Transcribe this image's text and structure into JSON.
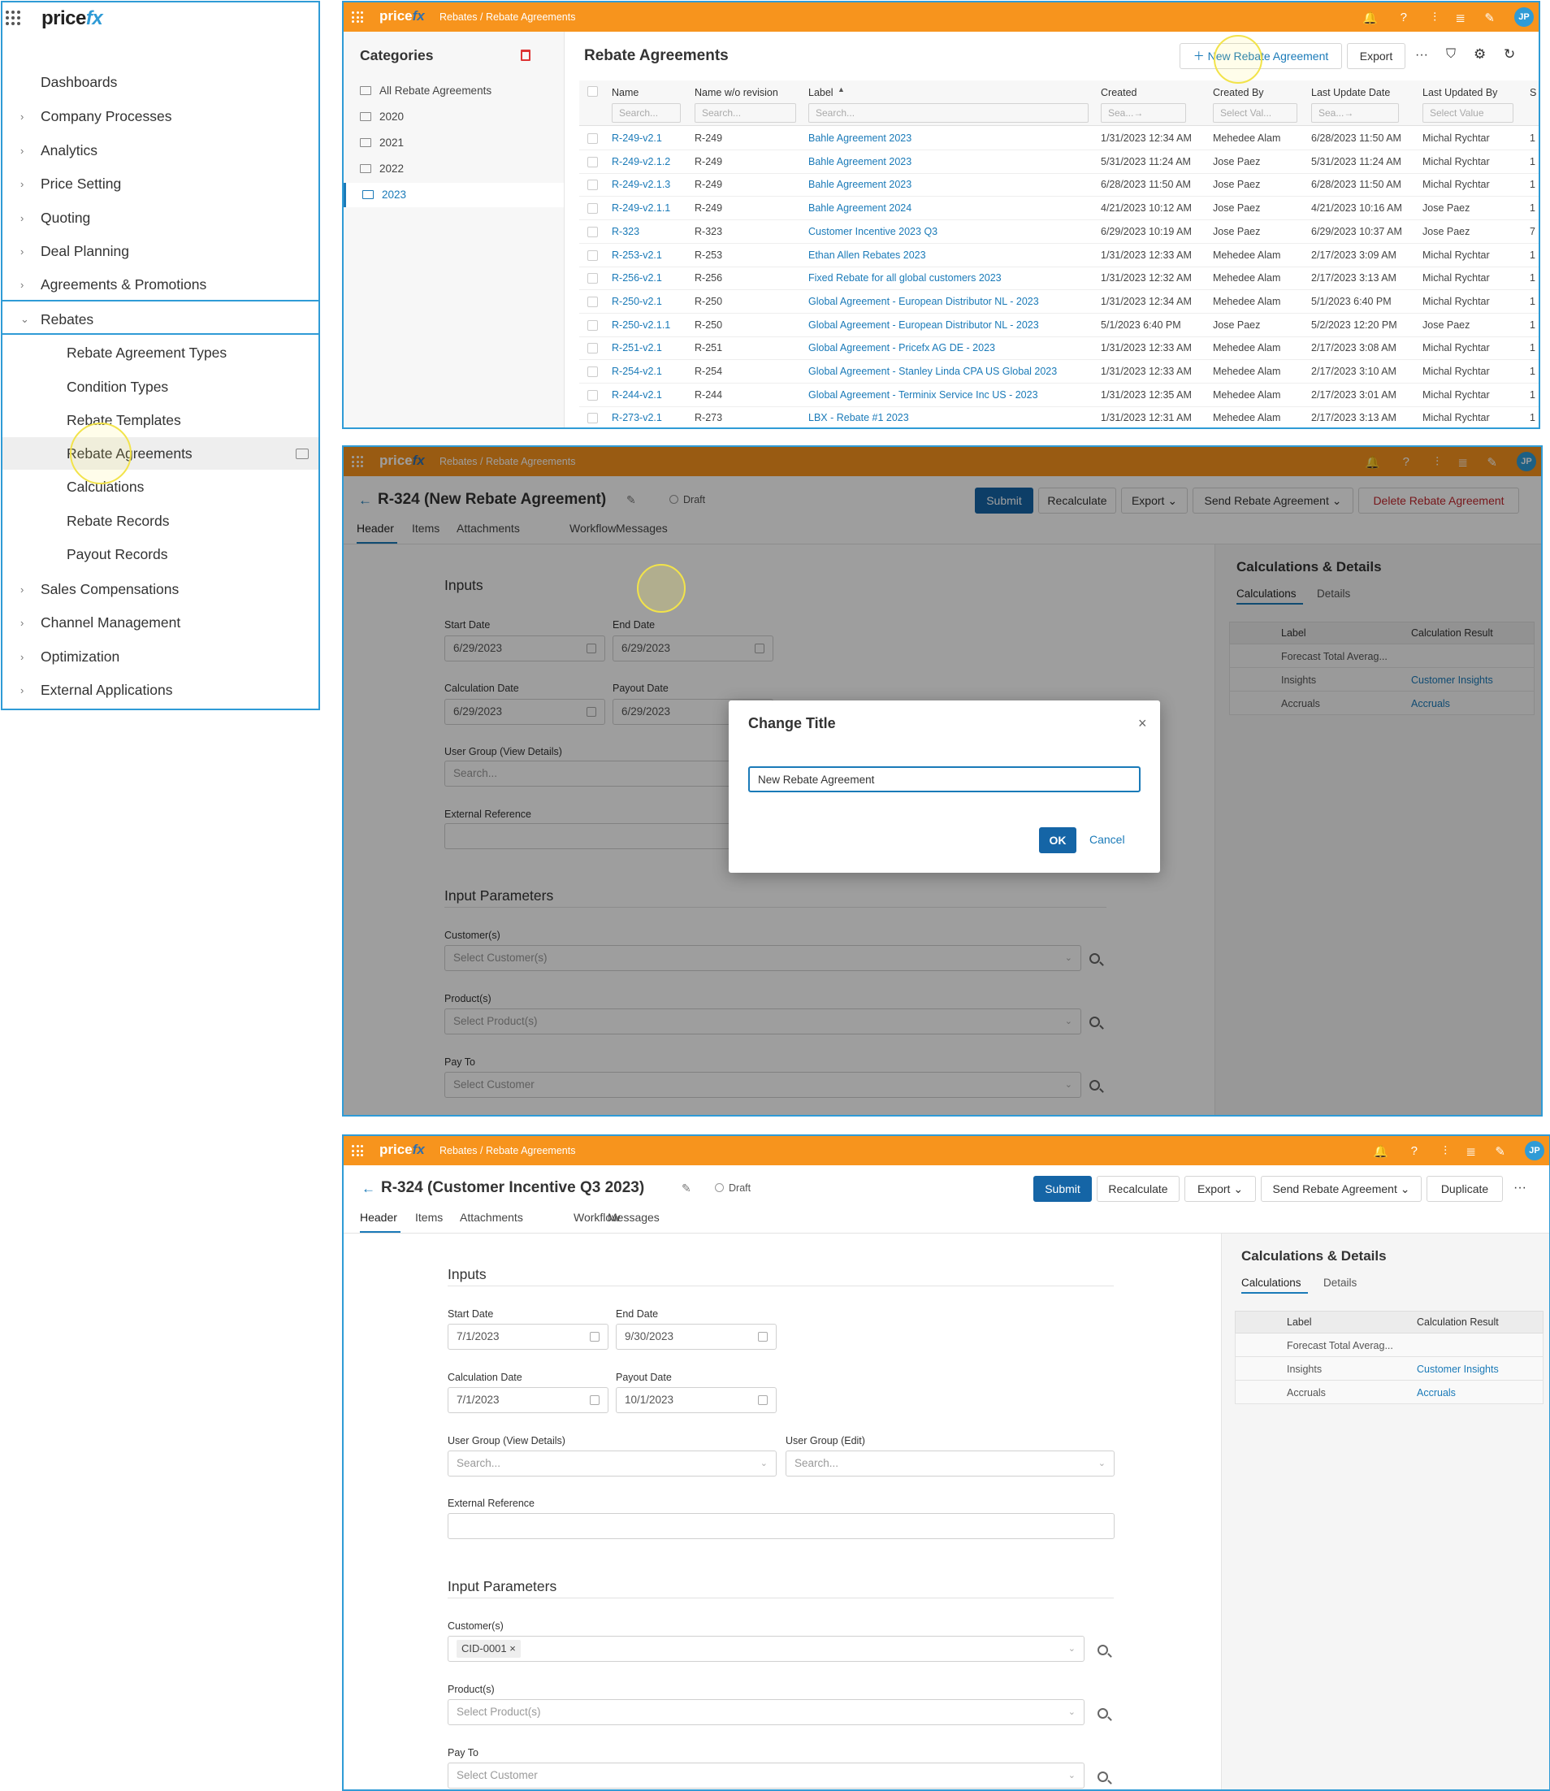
{
  "nav": {
    "logo_main": "price",
    "logo_accent": "fx",
    "items": [
      {
        "label": "Dashboards",
        "chevron": ""
      },
      {
        "label": "Company Processes",
        "chevron": "›"
      },
      {
        "label": "Analytics",
        "chevron": "›"
      },
      {
        "label": "Price Setting",
        "chevron": "›"
      },
      {
        "label": "Quoting",
        "chevron": "›"
      },
      {
        "label": "Deal Planning",
        "chevron": "›"
      },
      {
        "label": "Agreements & Promotions",
        "chevron": "›"
      },
      {
        "label": "Rebates",
        "chevron": "⌄"
      },
      {
        "label": "Rebate Agreement Types",
        "chevron": ""
      },
      {
        "label": "Condition Types",
        "chevron": ""
      },
      {
        "label": "Rebate Templates",
        "chevron": ""
      },
      {
        "label": "Rebate Agreements",
        "chevron": ""
      },
      {
        "label": "Calculations",
        "chevron": ""
      },
      {
        "label": "Rebate Records",
        "chevron": ""
      },
      {
        "label": "Payout Records",
        "chevron": ""
      },
      {
        "label": "Sales Compensations",
        "chevron": "›"
      },
      {
        "label": "Channel Management",
        "chevron": "›"
      },
      {
        "label": "Optimization",
        "chevron": "›"
      },
      {
        "label": "External Applications",
        "chevron": "›"
      }
    ]
  },
  "topbar": {
    "logo_main": "price",
    "logo_accent": "fx",
    "breadcrumb": "Rebates / Rebate Agreements",
    "avatar": "JP"
  },
  "list": {
    "categories_title": "Categories",
    "categories": [
      "All Rebate Agreements",
      "2020",
      "2021",
      "2022",
      "2023"
    ],
    "title": "Rebate Agreements",
    "new_button": "New Rebate Agreement",
    "export_button": "Export",
    "columns": [
      "Name",
      "Name w/o revision",
      "Label",
      "Created",
      "Created By",
      "Last Update Date",
      "Last Updated By",
      "S"
    ],
    "filters": [
      "Search...",
      "Search...",
      "Search...",
      "Sea...→",
      "Select Val...",
      "Sea...→",
      "Select Value"
    ],
    "rows": [
      [
        "R-249-v2.1",
        "R-249",
        "Bahle Agreement 2023",
        "1/31/2023 12:34 AM",
        "Mehedee Alam",
        "6/28/2023 11:50 AM",
        "Michal Rychtar",
        "1"
      ],
      [
        "R-249-v2.1.2",
        "R-249",
        "Bahle Agreement 2023",
        "5/31/2023 11:24 AM",
        "Jose Paez",
        "5/31/2023 11:24 AM",
        "Michal Rychtar",
        "1"
      ],
      [
        "R-249-v2.1.3",
        "R-249",
        "Bahle Agreement 2023",
        "6/28/2023 11:50 AM",
        "Jose Paez",
        "6/28/2023 11:50 AM",
        "Michal Rychtar",
        "1"
      ],
      [
        "R-249-v2.1.1",
        "R-249",
        "Bahle Agreement 2024",
        "4/21/2023 10:12 AM",
        "Jose Paez",
        "4/21/2023 10:16 AM",
        "Jose Paez",
        "1"
      ],
      [
        "R-323",
        "R-323",
        "Customer Incentive 2023 Q3",
        "6/29/2023 10:19 AM",
        "Jose Paez",
        "6/29/2023 10:37 AM",
        "Jose Paez",
        "7"
      ],
      [
        "R-253-v2.1",
        "R-253",
        "Ethan Allen Rebates 2023",
        "1/31/2023 12:33 AM",
        "Mehedee Alam",
        "2/17/2023 3:09 AM",
        "Michal Rychtar",
        "1"
      ],
      [
        "R-256-v2.1",
        "R-256",
        "Fixed Rebate for all global customers 2023",
        "1/31/2023 12:32 AM",
        "Mehedee Alam",
        "2/17/2023 3:13 AM",
        "Michal Rychtar",
        "1"
      ],
      [
        "R-250-v2.1",
        "R-250",
        "Global Agreement - European Distributor NL - 2023",
        "1/31/2023 12:34 AM",
        "Mehedee Alam",
        "5/1/2023 6:40 PM",
        "Michal Rychtar",
        "1"
      ],
      [
        "R-250-v2.1.1",
        "R-250",
        "Global Agreement - European Distributor NL - 2023",
        "5/1/2023 6:40 PM",
        "Jose Paez",
        "5/2/2023 12:20 PM",
        "Jose Paez",
        "1"
      ],
      [
        "R-251-v2.1",
        "R-251",
        "Global Agreement - Pricefx AG DE - 2023",
        "1/31/2023 12:33 AM",
        "Mehedee Alam",
        "2/17/2023 3:08 AM",
        "Michal Rychtar",
        "1"
      ],
      [
        "R-254-v2.1",
        "R-254",
        "Global Agreement - Stanley Linda CPA US Global 2023",
        "1/31/2023 12:33 AM",
        "Mehedee Alam",
        "2/17/2023 3:10 AM",
        "Michal Rychtar",
        "1"
      ],
      [
        "R-244-v2.1",
        "R-244",
        "Global Agreement - Terminix Service Inc US - 2023",
        "1/31/2023 12:35 AM",
        "Mehedee Alam",
        "2/17/2023 3:01 AM",
        "Michal Rychtar",
        "1"
      ],
      [
        "R-273-v2.1",
        "R-273",
        "LBX - Rebate #1 2023",
        "1/31/2023 12:31 AM",
        "Mehedee Alam",
        "2/17/2023 3:13 AM",
        "Michal Rychtar",
        "1"
      ]
    ]
  },
  "detail1": {
    "title": "R-324 (New Rebate Agreement)",
    "status": "Draft",
    "buttons": {
      "submit": "Submit",
      "recalculate": "Recalculate",
      "export": "Export",
      "send": "Send Rebate Agreement",
      "delete": "Delete Rebate Agreement"
    },
    "tabs": [
      "Header",
      "Items",
      "Attachments",
      "Workflow",
      "Messages"
    ],
    "inputs_h": "Inputs",
    "start_date_lbl": "Start Date",
    "start_date": "6/29/2023",
    "end_date_lbl": "End Date",
    "end_date": "6/29/2023",
    "calc_date_lbl": "Calculation Date",
    "calc_date": "6/29/2023",
    "payout_date_lbl": "Payout Date",
    "payout_date": "6/29/2023",
    "user_group_lbl": "User Group (View Details)",
    "user_group_ph": "Search...",
    "ext_ref_lbl": "External Reference",
    "params_h": "Input Parameters",
    "customers_lbl": "Customer(s)",
    "customers_ph": "Select Customer(s)",
    "products_lbl": "Product(s)",
    "products_ph": "Select Product(s)",
    "payto_lbl": "Pay To",
    "payto_ph": "Select Customer",
    "calc_h": "Calculations & Details",
    "calc_tabs": [
      "Calculations",
      "Details"
    ],
    "calc_cols": [
      "Label",
      "Calculation Result"
    ],
    "calc_rows": [
      [
        "Forecast Total Averag...",
        ""
      ],
      [
        "Insights",
        "Customer Insights"
      ],
      [
        "Accruals",
        "Accruals"
      ]
    ],
    "dialog": {
      "title": "Change Title",
      "value": "New Rebate Agreement",
      "ok": "OK",
      "cancel": "Cancel",
      "close": "×"
    }
  },
  "detail2": {
    "title": "R-324 (Customer Incentive Q3 2023)",
    "status": "Draft",
    "buttons": {
      "submit": "Submit",
      "recalculate": "Recalculate",
      "export": "Export",
      "send": "Send Rebate Agreement",
      "duplicate": "Duplicate",
      "more": "···"
    },
    "tabs": [
      "Header",
      "Items",
      "Attachments",
      "Workflow",
      "Messages"
    ],
    "inputs_h": "Inputs",
    "start_date_lbl": "Start Date",
    "start_date": "7/1/2023",
    "end_date_lbl": "End Date",
    "end_date": "9/30/2023",
    "calc_date_lbl": "Calculation Date",
    "calc_date": "7/1/2023",
    "payout_date_lbl": "Payout Date",
    "payout_date": "10/1/2023",
    "user_group_lbl": "User Group (View Details)",
    "user_group_ph": "Search...",
    "user_group_edit_lbl": "User Group (Edit)",
    "user_group_edit_ph": "Search...",
    "ext_ref_lbl": "External Reference",
    "params_h": "Input Parameters",
    "customers_lbl": "Customer(s)",
    "customer_tag": "CID-0001",
    "products_lbl": "Product(s)",
    "products_ph": "Select Product(s)",
    "payto_lbl": "Pay To",
    "payto_ph": "Select Customer",
    "calc_h": "Calculations & Details",
    "calc_tabs": [
      "Calculations",
      "Details"
    ],
    "calc_cols": [
      "Label",
      "Calculation Result"
    ],
    "calc_rows": [
      [
        "Forecast Total Averag...",
        ""
      ],
      [
        "Insights",
        "Customer Insights"
      ],
      [
        "Accruals",
        "Accruals"
      ]
    ]
  },
  "colors": {
    "accent": "#f7941d",
    "brand": "#2f9bd6",
    "primary": "#1565a6",
    "link": "#1a7ab8",
    "danger": "#c0262d"
  }
}
